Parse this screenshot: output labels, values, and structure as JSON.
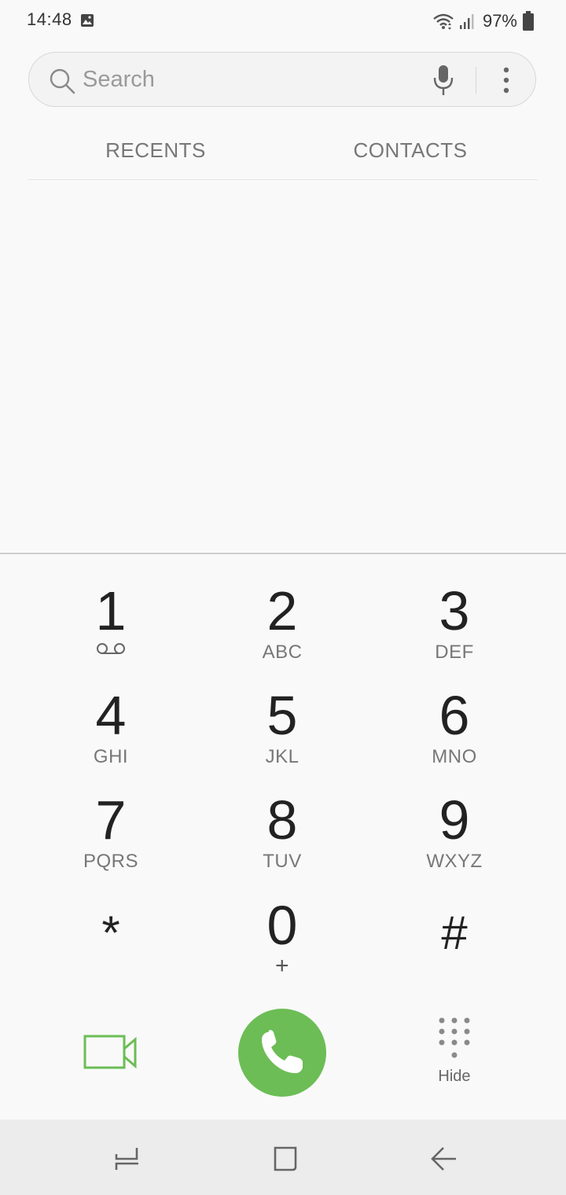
{
  "status_bar": {
    "time": "14:48",
    "battery": "97%",
    "icons": [
      "gallery-icon",
      "wifi-icon",
      "signal-icon",
      "battery-icon"
    ]
  },
  "search": {
    "placeholder": "Search",
    "icons": [
      "search-icon",
      "mic-icon",
      "more-options-icon"
    ]
  },
  "tabs": [
    {
      "label": "RECENTS"
    },
    {
      "label": "CONTACTS"
    }
  ],
  "keypad": {
    "keys": [
      {
        "digit": "1",
        "letters": "",
        "icon": "voicemail-icon"
      },
      {
        "digit": "2",
        "letters": "ABC"
      },
      {
        "digit": "3",
        "letters": "DEF"
      },
      {
        "digit": "4",
        "letters": "GHI"
      },
      {
        "digit": "5",
        "letters": "JKL"
      },
      {
        "digit": "6",
        "letters": "MNO"
      },
      {
        "digit": "7",
        "letters": "PQRS"
      },
      {
        "digit": "8",
        "letters": "TUV"
      },
      {
        "digit": "9",
        "letters": "WXYZ"
      },
      {
        "digit": "*",
        "letters": ""
      },
      {
        "digit": "0",
        "letters": "+"
      },
      {
        "digit": "#",
        "letters": ""
      }
    ]
  },
  "actions": {
    "video_icon": "video-call-icon",
    "call_icon": "phone-icon",
    "hide_label": "Hide"
  },
  "colors": {
    "accent_green": "#6cbd55",
    "background": "#f9f9f9",
    "nav_bar": "#ececec"
  },
  "nav_bar": {
    "icons": [
      "recent-apps-icon",
      "home-icon",
      "back-icon"
    ]
  }
}
